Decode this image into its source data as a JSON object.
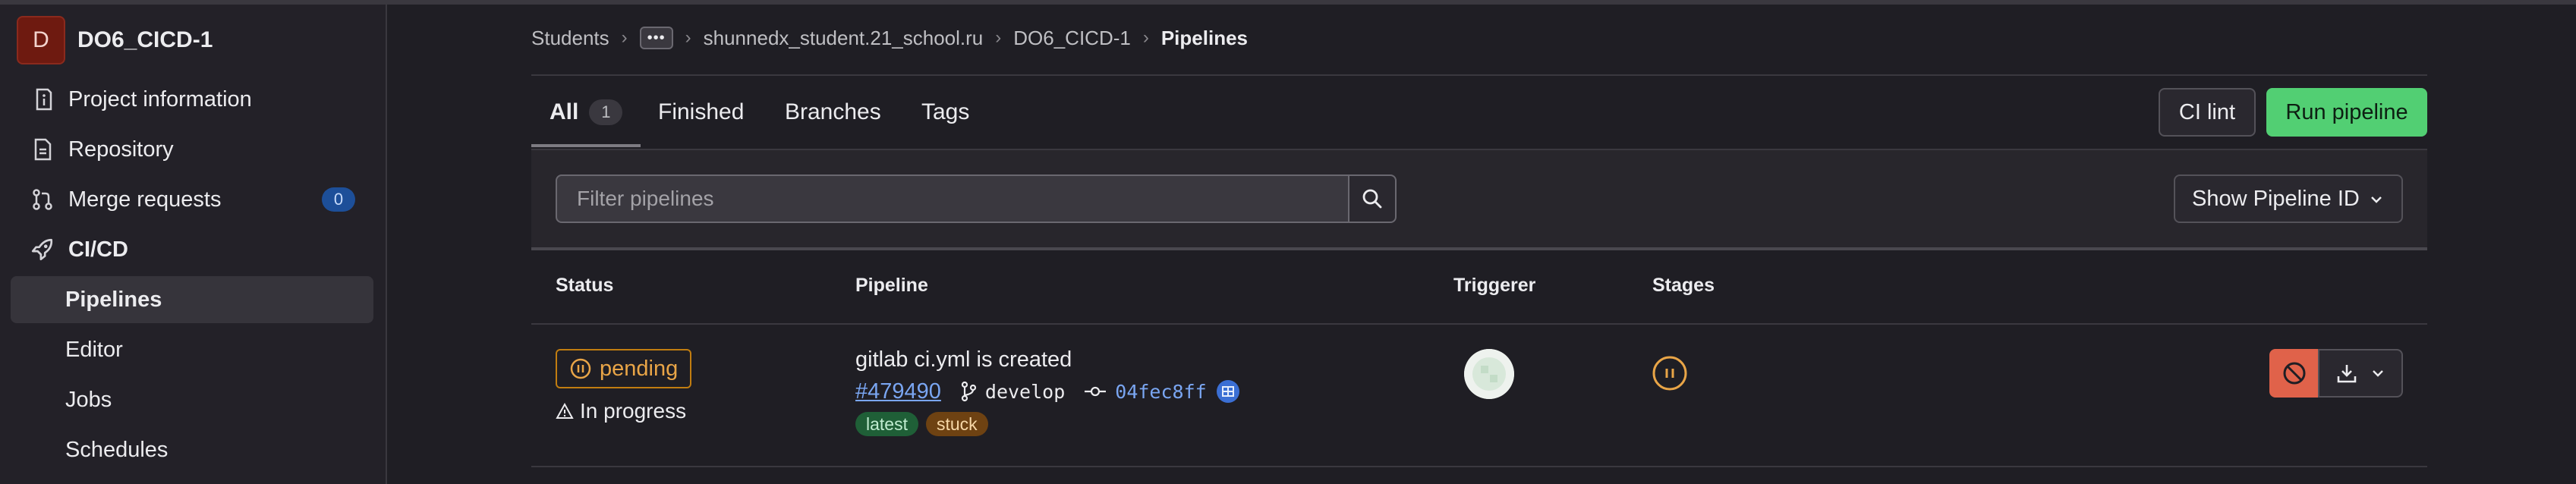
{
  "sidebar": {
    "project_initial": "D",
    "project_name": "DO6_CICD-1",
    "items": [
      {
        "label": "Project information",
        "icon": "info-document-icon"
      },
      {
        "label": "Repository",
        "icon": "document-icon"
      },
      {
        "label": "Merge requests",
        "icon": "merge-request-icon",
        "count": "0"
      },
      {
        "label": "CI/CD",
        "icon": "rocket-icon"
      },
      {
        "label": "Pipelines"
      },
      {
        "label": "Editor"
      },
      {
        "label": "Jobs"
      },
      {
        "label": "Schedules"
      }
    ]
  },
  "breadcrumb": {
    "items": [
      "Students",
      "shunnedx_student.21_school.ru",
      "DO6_CICD-1"
    ],
    "current": "Pipelines",
    "ellipsis": "•••",
    "separator": "›"
  },
  "tabs": [
    {
      "label": "All",
      "count": "1"
    },
    {
      "label": "Finished"
    },
    {
      "label": "Branches"
    },
    {
      "label": "Tags"
    }
  ],
  "actions": {
    "ci_lint": "CI lint",
    "run_pipeline": "Run pipeline"
  },
  "filter": {
    "placeholder": "Filter pipelines",
    "show_id": "Show Pipeline ID"
  },
  "table": {
    "headers": [
      "Status",
      "Pipeline",
      "Triggerer",
      "Stages"
    ],
    "rows": [
      {
        "status": "pending",
        "status_detail": "In progress",
        "title": "gitlab ci.yml is created",
        "id": "#479490",
        "branch": "develop",
        "commit": "04fec8ff",
        "tags": [
          "latest",
          "stuck"
        ]
      }
    ]
  },
  "colors": {
    "accent_confirm": "#52cf73",
    "pending": "#e9a547",
    "danger": "#e0624a",
    "link": "#7aa6f2"
  }
}
